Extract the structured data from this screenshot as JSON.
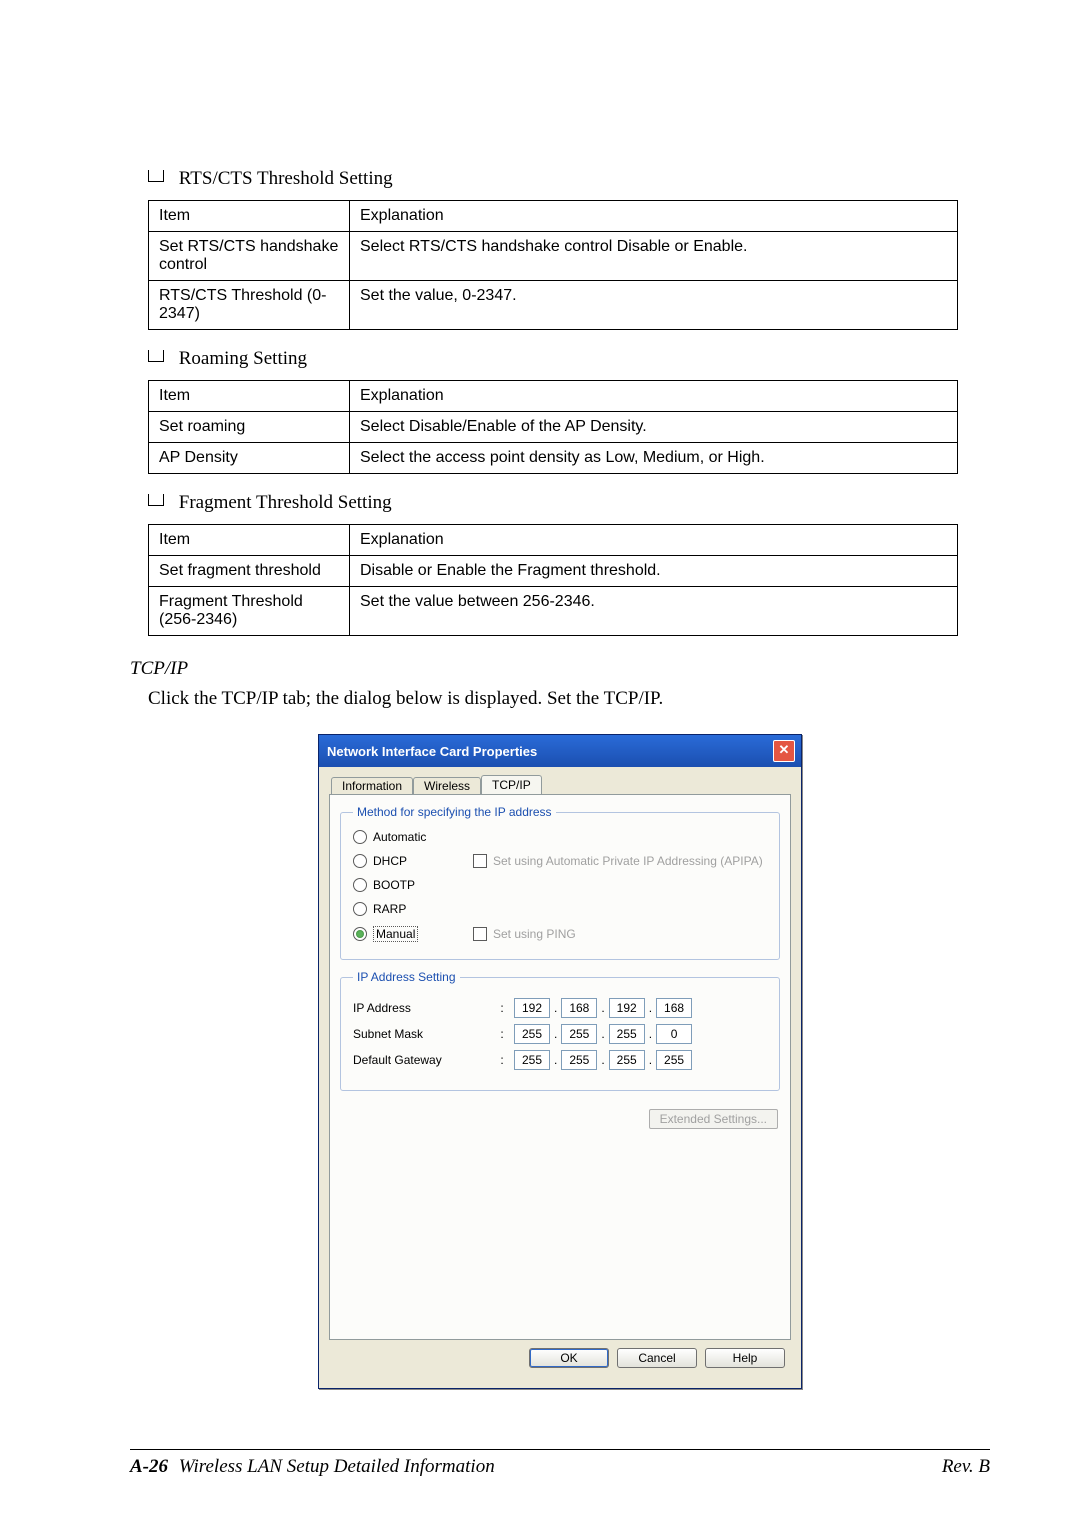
{
  "headings": {
    "rts": "RTS/CTS Threshold Setting",
    "roaming": "Roaming Setting",
    "fragment": "Fragment Threshold Setting"
  },
  "tables": {
    "rts": {
      "h1": "Item",
      "h2": "Explanation",
      "r1c1": "Set RTS/CTS handshake control",
      "r1c2": "Select RTS/CTS handshake control Disable or Enable.",
      "r2c1": "RTS/CTS Threshold (0-2347)",
      "r2c2": "Set the value, 0-2347."
    },
    "roaming": {
      "h1": "Item",
      "h2": "Explanation",
      "r1c1": "Set roaming",
      "r1c2": "Select Disable/Enable of the AP Density.",
      "r2c1": "AP Density",
      "r2c2": "Select the access point density as Low, Medium, or High."
    },
    "fragment": {
      "h1": "Item",
      "h2": "Explanation",
      "r1c1": "Set fragment threshold",
      "r1c2": "Disable or Enable the Fragment threshold.",
      "r2c1": "Fragment Threshold (256-2346)",
      "r2c2": "Set the value between 256-2346."
    }
  },
  "section": {
    "tcpip_title": "TCP/IP",
    "tcpip_instruction": "Click the TCP/IP tab; the dialog below is displayed. Set the TCP/IP."
  },
  "dialog": {
    "title": "Network Interface Card Properties",
    "close": "✕",
    "tabs": {
      "info": "Information",
      "wireless": "Wireless",
      "tcpip": "TCP/IP"
    },
    "method_legend": "Method for specifying the IP address",
    "radios": {
      "auto": "Automatic",
      "dhcp": "DHCP",
      "bootp": "BOOTP",
      "rarp": "RARP",
      "manual": "Manual"
    },
    "checks": {
      "apipa": "Set using Automatic Private IP Addressing (APIPA)",
      "ping": "Set using PING"
    },
    "ipset_legend": "IP Address Setting",
    "labels": {
      "ip": "IP Address",
      "mask": "Subnet Mask",
      "gw": "Default Gateway"
    },
    "ip": {
      "a": "192",
      "b": "168",
      "c": "192",
      "d": "168"
    },
    "mask": {
      "a": "255",
      "b": "255",
      "c": "255",
      "d": "0"
    },
    "gw": {
      "a": "255",
      "b": "255",
      "c": "255",
      "d": "255"
    },
    "ext": "Extended Settings...",
    "buttons": {
      "ok": "OK",
      "cancel": "Cancel",
      "help": "Help"
    }
  },
  "footer": {
    "page": "A-26",
    "title": "Wireless LAN Setup Detailed Information",
    "rev": "Rev. B"
  }
}
